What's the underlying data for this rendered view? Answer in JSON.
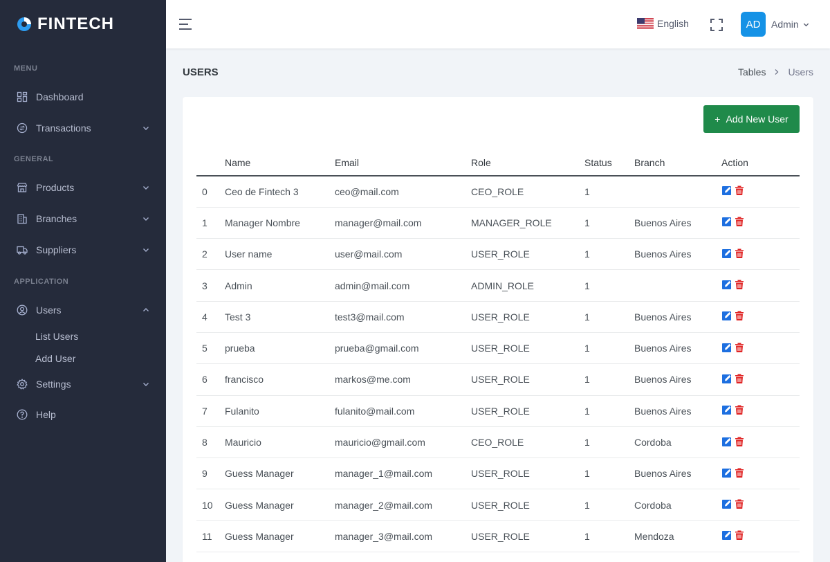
{
  "brand": {
    "name": "FINTECH"
  },
  "colors": {
    "sidebar_bg": "#252b3b",
    "accent_blue": "#1592e6",
    "add_button": "#1f8a4a",
    "delete_red": "#e02424"
  },
  "sidebar": {
    "sections": [
      {
        "title": "MENU",
        "items": [
          {
            "label": "Dashboard",
            "icon": "dashboard-icon",
            "has_arrow": false
          },
          {
            "label": "Transactions",
            "icon": "transactions-icon",
            "has_arrow": true
          }
        ]
      },
      {
        "title": "GENERAL",
        "items": [
          {
            "label": "Products",
            "icon": "store-icon",
            "has_arrow": true
          },
          {
            "label": "Branches",
            "icon": "building-icon",
            "has_arrow": true
          },
          {
            "label": "Suppliers",
            "icon": "truck-icon",
            "has_arrow": true
          }
        ]
      },
      {
        "title": "APPLICATION",
        "items": [
          {
            "label": "Users",
            "icon": "user-icon",
            "has_arrow": true,
            "expanded": true
          },
          {
            "label": "Settings",
            "icon": "gear-icon",
            "has_arrow": true
          },
          {
            "label": "Help",
            "icon": "help-icon",
            "has_arrow": false
          }
        ]
      }
    ],
    "users_submenu": [
      "List Users",
      "Add User"
    ]
  },
  "header": {
    "language": "English",
    "avatar_initials": "AD",
    "user_name": "Admin"
  },
  "page": {
    "title": "USERS",
    "breadcrumb": [
      "Tables",
      "Users"
    ],
    "add_button": "Add New User"
  },
  "table": {
    "columns": [
      "",
      "Name",
      "Email",
      "Role",
      "Status",
      "Branch",
      "Action"
    ],
    "rows": [
      {
        "id": "0",
        "name": "Ceo de Fintech 3",
        "email": "ceo@mail.com",
        "role": "CEO_ROLE",
        "status": "1",
        "branch": ""
      },
      {
        "id": "1",
        "name": "Manager Nombre",
        "email": "manager@mail.com",
        "role": "MANAGER_ROLE",
        "status": "1",
        "branch": "Buenos Aires"
      },
      {
        "id": "2",
        "name": "User name",
        "email": "user@mail.com",
        "role": "USER_ROLE",
        "status": "1",
        "branch": "Buenos Aires"
      },
      {
        "id": "3",
        "name": "Admin",
        "email": "admin@mail.com",
        "role": "ADMIN_ROLE",
        "status": "1",
        "branch": ""
      },
      {
        "id": "4",
        "name": "Test 3",
        "email": "test3@mail.com",
        "role": "USER_ROLE",
        "status": "1",
        "branch": "Buenos Aires"
      },
      {
        "id": "5",
        "name": "prueba",
        "email": "prueba@gmail.com",
        "role": "USER_ROLE",
        "status": "1",
        "branch": "Buenos Aires"
      },
      {
        "id": "6",
        "name": "francisco",
        "email": "markos@me.com",
        "role": "USER_ROLE",
        "status": "1",
        "branch": "Buenos Aires"
      },
      {
        "id": "7",
        "name": "Fulanito",
        "email": "fulanito@mail.com",
        "role": "USER_ROLE",
        "status": "1",
        "branch": "Buenos Aires"
      },
      {
        "id": "8",
        "name": "Mauricio",
        "email": "mauricio@gmail.com",
        "role": "CEO_ROLE",
        "status": "1",
        "branch": "Cordoba"
      },
      {
        "id": "9",
        "name": "Guess Manager",
        "email": "manager_1@mail.com",
        "role": "USER_ROLE",
        "status": "1",
        "branch": "Buenos Aires"
      },
      {
        "id": "10",
        "name": "Guess Manager",
        "email": "manager_2@mail.com",
        "role": "USER_ROLE",
        "status": "1",
        "branch": "Cordoba"
      },
      {
        "id": "11",
        "name": "Guess Manager",
        "email": "manager_3@mail.com",
        "role": "USER_ROLE",
        "status": "1",
        "branch": "Mendoza"
      }
    ]
  }
}
